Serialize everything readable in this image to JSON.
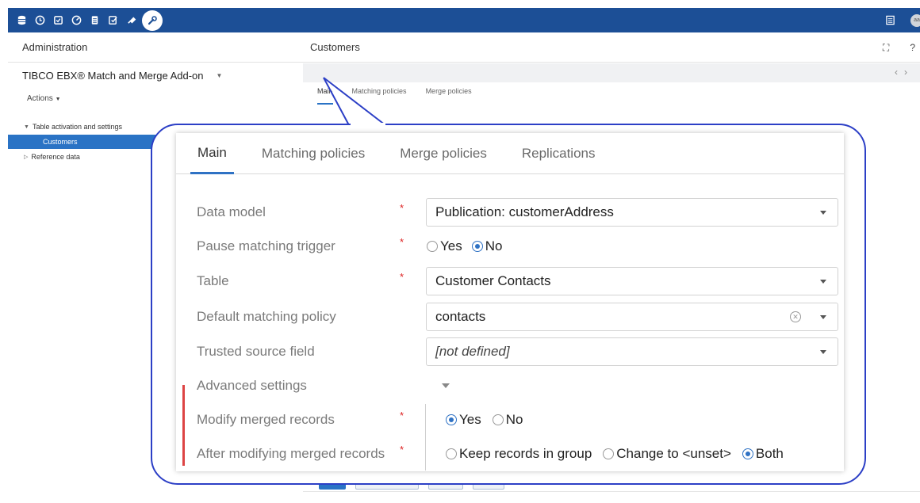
{
  "topbar": {
    "icons": [
      "database-icon",
      "clock-icon",
      "checkbox-icon",
      "dashboard-icon",
      "document-icon",
      "edit-check-icon",
      "plug-icon",
      "wrench-icon"
    ],
    "right_icons": [
      "grid-icon",
      "user-avatar"
    ],
    "avatar_text": "aa",
    "bg_color": "#1c4f96"
  },
  "left": {
    "header": "Administration",
    "app_title": "TIBCO EBX® Match and Merge Add-on",
    "actions_label": "Actions",
    "tree": [
      {
        "label": "Table activation and settings",
        "expanded": true
      },
      {
        "label": "Customers",
        "selected": true
      },
      {
        "label": "Reference data",
        "expanded": false
      }
    ]
  },
  "right": {
    "header": "Customers",
    "small_tabs": [
      "Main",
      "Matching policies",
      "Merge policies"
    ]
  },
  "card": {
    "tabs": [
      "Main",
      "Matching policies",
      "Merge policies",
      "Replications"
    ],
    "rows": {
      "data_model": {
        "label": "Data model",
        "value": "Publication: customerAddress"
      },
      "pause_trigger": {
        "label": "Pause matching trigger",
        "options": [
          "Yes",
          "No"
        ],
        "selected": "No"
      },
      "table": {
        "label": "Table",
        "value": "Customer Contacts"
      },
      "default_policy": {
        "label": "Default matching policy",
        "value": "contacts"
      },
      "trusted_source": {
        "label": "Trusted source field",
        "value": "[not defined]"
      },
      "advanced": {
        "label": "Advanced settings"
      },
      "modify_merged": {
        "label": "Modify merged records",
        "options": [
          "Yes",
          "No"
        ],
        "selected": "Yes"
      },
      "after_modifying": {
        "label": "After modifying merged records",
        "options": [
          "Keep records in group",
          "Change to <unset>",
          "Both"
        ],
        "selected": "Both"
      }
    },
    "required_mark": "*"
  },
  "colors": {
    "accent": "#2f72c4",
    "callout": "#2c3fc6",
    "required": "#dd2222"
  }
}
